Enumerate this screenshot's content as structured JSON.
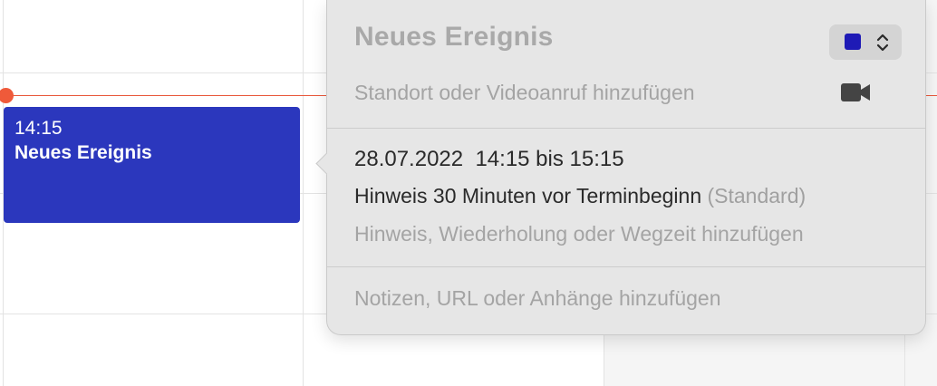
{
  "event": {
    "time": "14:15",
    "title": "Neues Ereignis",
    "color": "#2b37bd"
  },
  "popover": {
    "title": "Neues Ereignis",
    "color_swatch": "#1e1ab6",
    "location_placeholder": "Standort oder Videoanruf hinzufügen",
    "date_time": "28.07.2022  14:15 bis 15:15",
    "alert_text": "Hinweis 30 Minuten vor Terminbeginn",
    "alert_default": "(Standard)",
    "add_options": "Hinweis, Wiederholung oder Wegzeit hinzufügen",
    "notes_placeholder": "Notizen, URL oder Anhänge hinzufügen"
  },
  "icons": {
    "video": "video-camera-icon",
    "stepper": "chevron-up-down-icon"
  },
  "colors": {
    "now_line": "#e8573a"
  }
}
